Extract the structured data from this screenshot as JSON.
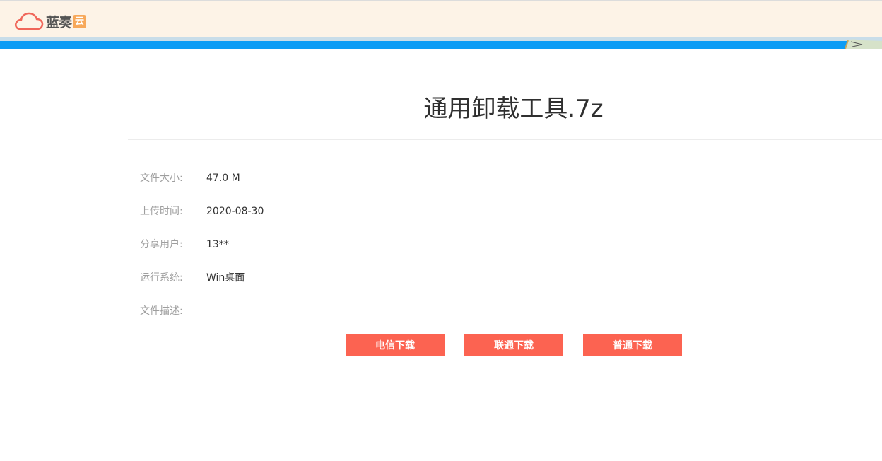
{
  "header": {
    "logo_text": "蓝奏",
    "logo_badge": "云"
  },
  "progress": {
    "percent": 96
  },
  "file": {
    "title": "通用卸载工具.7z",
    "info": [
      {
        "label": "文件大小:",
        "value": "47.0 M"
      },
      {
        "label": "上传时间:",
        "value": "2020-08-30"
      },
      {
        "label": "分享用户:",
        "value": "13**"
      },
      {
        "label": "运行系统:",
        "value": "Win桌面"
      },
      {
        "label": "文件描述:",
        "value": ""
      }
    ]
  },
  "downloads": {
    "telecom": "电信下载",
    "unicom": "联通下载",
    "normal": "普通下载"
  },
  "colors": {
    "header_bg": "#fdf3e7",
    "progress_blue": "#0b9cf5",
    "button_red": "#fc6351"
  }
}
